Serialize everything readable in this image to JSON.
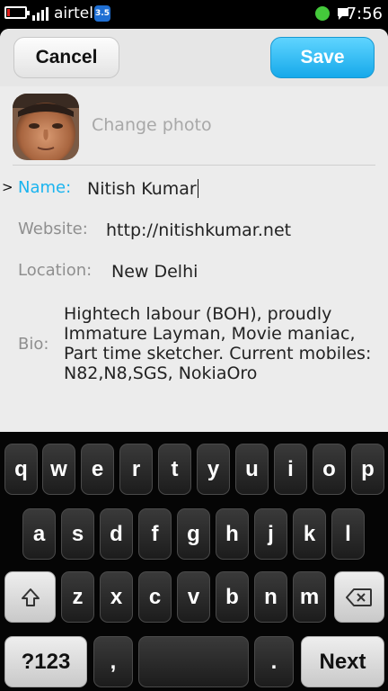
{
  "status_bar": {
    "carrier": "airtel",
    "network_badge": "3.5",
    "time": "7:56",
    "battery_level": 0.15,
    "signal_bars": 4,
    "icons": [
      "battery-icon",
      "signal-icon",
      "network-3-5g-icon",
      "notification-dot-icon",
      "chat-icon"
    ]
  },
  "toolbar": {
    "cancel_label": "Cancel",
    "save_label": "Save"
  },
  "profile": {
    "change_photo_label": "Change photo",
    "avatar_icon": "profile-photo"
  },
  "fields": {
    "name_label": "Name:",
    "name_value": "Nitish Kumar",
    "website_label": "Website:",
    "website_value": "http://nitishkumar.net",
    "location_label": "Location:",
    "location_value": "New Delhi",
    "bio_label": "Bio:",
    "bio_lines": [
      "Hightech labour (BOH), proudly",
      "Immature Layman, Movie maniac,",
      "Part time sketcher. Current mobiles:",
      "N82,N8,SGS, NokiaOro"
    ]
  },
  "focus_marker": ">",
  "keyboard": {
    "row1": [
      "q",
      "w",
      "e",
      "r",
      "t",
      "y",
      "u",
      "i",
      "o",
      "p"
    ],
    "row2": [
      "a",
      "s",
      "d",
      "f",
      "g",
      "h",
      "j",
      "k",
      "l"
    ],
    "row3": [
      "z",
      "x",
      "c",
      "v",
      "b",
      "n",
      "m"
    ],
    "symbols_label": "?123",
    "comma": ",",
    "period": ".",
    "next_label": "Next",
    "shift_icon": "shift-icon",
    "backspace_icon": "backspace-icon"
  },
  "colors": {
    "accent": "#1ab4ef",
    "save_button": "#16a9ea",
    "panel_background": "#ececec"
  }
}
